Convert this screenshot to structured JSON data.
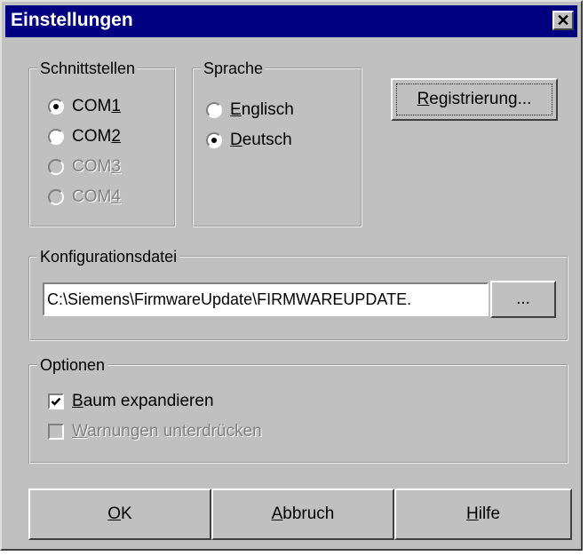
{
  "window": {
    "title": "Einstellungen",
    "close_glyph": "✕"
  },
  "schnittstellen": {
    "legend": "Schnittstellen",
    "items": [
      {
        "pre": "COM",
        "mnemonic": "1",
        "post": "",
        "checked": true,
        "enabled": true
      },
      {
        "pre": "COM",
        "mnemonic": "2",
        "post": "",
        "checked": false,
        "enabled": true
      },
      {
        "pre": "COM",
        "mnemonic": "3",
        "post": "",
        "checked": false,
        "enabled": false
      },
      {
        "pre": "COM",
        "mnemonic": "4",
        "post": "",
        "checked": false,
        "enabled": false
      }
    ]
  },
  "sprache": {
    "legend": "Sprache",
    "items": [
      {
        "pre": "",
        "mnemonic": "E",
        "post": "nglisch",
        "checked": false,
        "enabled": true
      },
      {
        "pre": "",
        "mnemonic": "D",
        "post": "eutsch",
        "checked": true,
        "enabled": true
      }
    ]
  },
  "registrierung": {
    "mnemonic": "R",
    "rest": "egistrierung..."
  },
  "konfiguration": {
    "legend": "Konfigurationsdatei",
    "path": "C:\\Siemens\\FirmwareUpdate\\FIRMWAREUPDATE.",
    "browse_label": "..."
  },
  "optionen": {
    "legend": "Optionen",
    "items": [
      {
        "mnemonic": "B",
        "rest": "aum expandieren",
        "checked": true,
        "enabled": true
      },
      {
        "mnemonic": "W",
        "rest": "arnungen unterdrücken",
        "checked": false,
        "enabled": false
      }
    ]
  },
  "buttons": {
    "ok": {
      "mnemonic": "O",
      "rest": "K"
    },
    "abbruch": {
      "mnemonic": "A",
      "rest": "bbruch"
    },
    "hilfe": {
      "mnemonic": "H",
      "rest": "ilfe"
    }
  },
  "colors": {
    "face": "#c0c0c0",
    "title_bg": "#000080",
    "disabled_text": "#808080"
  }
}
